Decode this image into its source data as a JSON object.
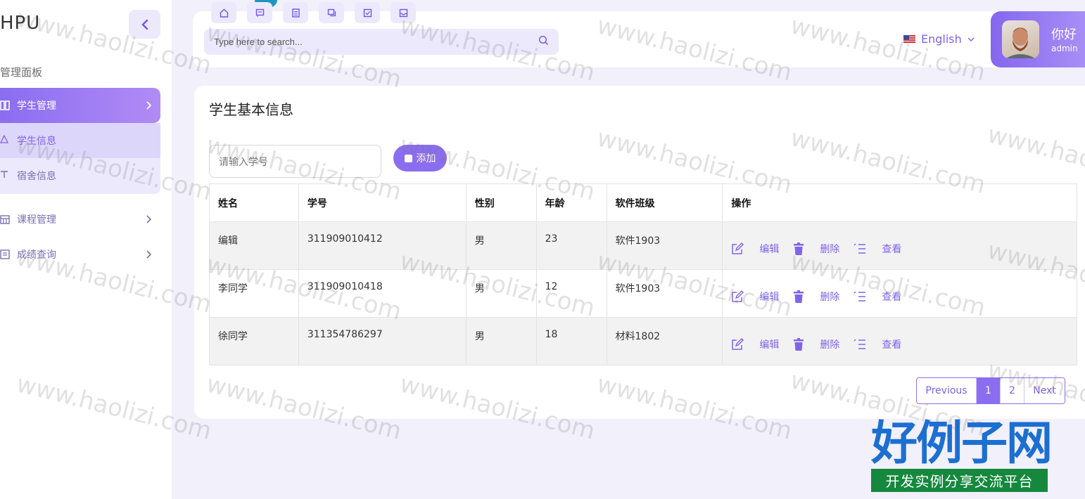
{
  "sidebar": {
    "brand": "HPU",
    "section_label": "管理面板",
    "menus": [
      {
        "label": "学生管理"
      },
      {
        "label": "课程管理"
      },
      {
        "label": "成绩查询"
      }
    ],
    "submenu": [
      {
        "label": "学生信息"
      },
      {
        "label": "宿舍信息"
      }
    ]
  },
  "topbar": {
    "search_placeholder": "Type here to search...",
    "language": "English",
    "user_greeting": "你好",
    "user_role": "admin"
  },
  "main": {
    "title": "学生基本信息",
    "student_id_placeholder": "请输入学号",
    "add_label": "添加",
    "columns": [
      "姓名",
      "学号",
      "性别",
      "年龄",
      "软件班级",
      "操作"
    ],
    "rows": [
      {
        "name": "编辑",
        "id": "311909010412",
        "gender": "男",
        "age": "23",
        "class": "软件1903"
      },
      {
        "name": "李同学",
        "id": "311909010418",
        "gender": "男",
        "age": "12",
        "class": "软件1903"
      },
      {
        "name": "徐同学",
        "id": "311354786297",
        "gender": "男",
        "age": "18",
        "class": "材料1802"
      }
    ],
    "actions": {
      "edit": "编辑",
      "delete": "删除",
      "view": "查看"
    },
    "pagination": {
      "previous": "Previous",
      "pages": [
        "1",
        "2"
      ],
      "current": "1",
      "next": "Next"
    }
  },
  "watermark": "www.haolizi.com",
  "logo": {
    "main": "好例子网",
    "tagline": "开发实例分享交流平台"
  },
  "colors": {
    "accent": "#8b6df0",
    "accent_light": "#ece9fd",
    "text_accent": "#7f64ea"
  }
}
